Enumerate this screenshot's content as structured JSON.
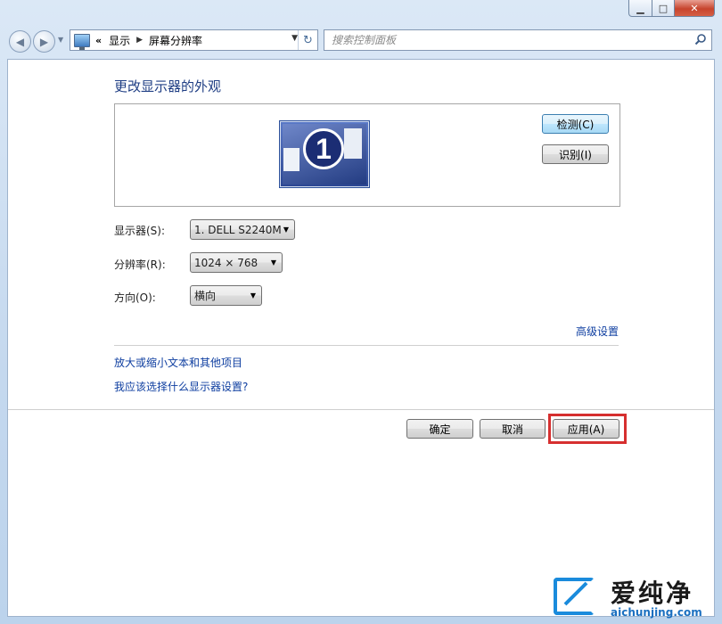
{
  "window": {
    "minimize_glyph": "▁",
    "maximize_glyph": "□",
    "close_glyph": "✕"
  },
  "nav": {
    "back_glyph": "◀",
    "forward_glyph": "▶",
    "history_glyph": "▼",
    "breadcrumb_overflow": "«",
    "breadcrumb": [
      "显示",
      "屏幕分辨率"
    ],
    "breadcrumb_sep": "▶",
    "address_dropdown_glyph": "▼",
    "refresh_glyph": "↻",
    "search_placeholder": "搜索控制面板"
  },
  "main": {
    "title": "更改显示器的外观",
    "monitor_number": "1",
    "detect_button": "检测(C)",
    "identify_button": "识别(I)",
    "fields": {
      "display_label": "显示器(S):",
      "display_value": "1. DELL S2240M",
      "resolution_label": "分辨率(R):",
      "resolution_value": "1024 × 768",
      "orientation_label": "方向(O):",
      "orientation_value": "横向"
    },
    "advanced_link": "高级设置",
    "links": [
      "放大或缩小文本和其他项目",
      "我应该选择什么显示器设置?"
    ]
  },
  "footer": {
    "ok_button": "确定",
    "cancel_button": "取消",
    "apply_button": "应用(A)"
  },
  "watermark": {
    "text_cn": "爱纯净",
    "text_en": "aichunjing.com"
  },
  "colors": {
    "title": "#1f3e84",
    "link": "#0e3ea0",
    "highlight": "#d62f2f"
  }
}
